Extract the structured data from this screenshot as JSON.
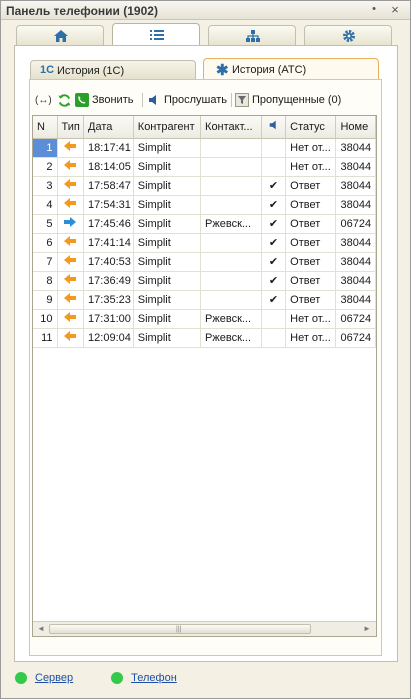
{
  "window": {
    "title": "Панель телефонии (1902)",
    "pin": "•",
    "close": "×"
  },
  "main_tabs": [
    {
      "icon": "home-icon"
    },
    {
      "icon": "list-icon"
    },
    {
      "icon": "org-structure-icon"
    },
    {
      "icon": "gear-icon"
    }
  ],
  "sub_tabs": {
    "history_1c": "История (1С)",
    "history_1c_icon_text": "1С",
    "history_ats": "История (АТС)"
  },
  "toolbar": {
    "arrows_glyph": "(↔)",
    "call": "Звонить",
    "listen": "Прослушать",
    "missed": "Пропущенные (0)"
  },
  "table": {
    "columns": [
      "N",
      "Тип",
      "Дата",
      "Контрагент",
      "Контакт...",
      "",
      "Статус",
      "Номе"
    ],
    "rows": [
      {
        "n": "1",
        "type": "incoming",
        "time": "18:17:41",
        "counterparty": "Simplit",
        "contact": "",
        "rec": "",
        "status": "Нет от...",
        "number": "38044"
      },
      {
        "n": "2",
        "type": "incoming",
        "time": "18:14:05",
        "counterparty": "Simplit",
        "contact": "",
        "rec": "",
        "status": "Нет от...",
        "number": "38044"
      },
      {
        "n": "3",
        "type": "incoming",
        "time": "17:58:47",
        "counterparty": "Simplit",
        "contact": "",
        "rec": "✔",
        "status": "Ответ",
        "number": "38044"
      },
      {
        "n": "4",
        "type": "incoming",
        "time": "17:54:31",
        "counterparty": "Simplit",
        "contact": "",
        "rec": "✔",
        "status": "Ответ",
        "number": "38044"
      },
      {
        "n": "5",
        "type": "outgoing",
        "time": "17:45:46",
        "counterparty": "Simplit",
        "contact": "Ржевск...",
        "rec": "✔",
        "status": "Ответ",
        "number": "06724"
      },
      {
        "n": "6",
        "type": "incoming",
        "time": "17:41:14",
        "counterparty": "Simplit",
        "contact": "",
        "rec": "✔",
        "status": "Ответ",
        "number": "38044"
      },
      {
        "n": "7",
        "type": "incoming",
        "time": "17:40:53",
        "counterparty": "Simplit",
        "contact": "",
        "rec": "✔",
        "status": "Ответ",
        "number": "38044"
      },
      {
        "n": "8",
        "type": "incoming",
        "time": "17:36:49",
        "counterparty": "Simplit",
        "contact": "",
        "rec": "✔",
        "status": "Ответ",
        "number": "38044"
      },
      {
        "n": "9",
        "type": "incoming",
        "time": "17:35:23",
        "counterparty": "Simplit",
        "contact": "",
        "rec": "✔",
        "status": "Ответ",
        "number": "38044"
      },
      {
        "n": "10",
        "type": "incoming",
        "time": "17:31:00",
        "counterparty": "Simplit",
        "contact": "Ржевск...",
        "rec": "",
        "status": "Нет от...",
        "number": "06724"
      },
      {
        "n": "11",
        "type": "incoming",
        "time": "12:09:04",
        "counterparty": "Simplit",
        "contact": "Ржевск...",
        "rec": "",
        "status": "Нет от...",
        "number": "06724"
      }
    ]
  },
  "status_bar": {
    "server": "Сервер",
    "phone": "Телефон"
  },
  "colors": {
    "incoming_arrow": "#f39a1e",
    "outgoing_arrow": "#2b8fd8",
    "selection": "#5b8ed6",
    "status_ok": "#33c94a"
  }
}
